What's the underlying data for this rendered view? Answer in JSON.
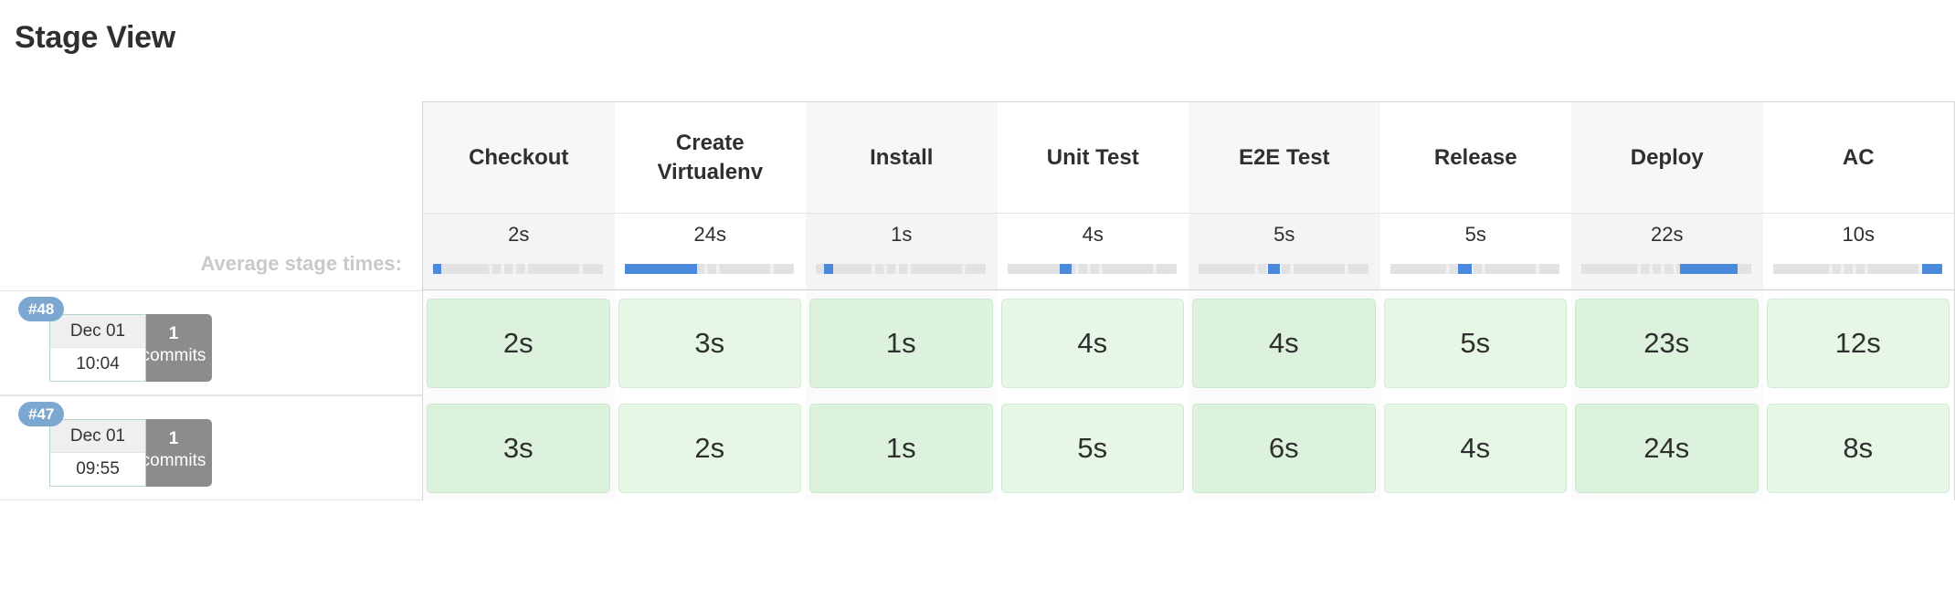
{
  "page": {
    "title": "Stage View"
  },
  "table": {
    "average_label": "Average stage times:",
    "stages": [
      "Checkout",
      "Create Virtualenv",
      "Install",
      "Unit Test",
      "E2E Test",
      "Release",
      "Deploy",
      "AC"
    ],
    "average_times": [
      "2s",
      "24s",
      "1s",
      "4s",
      "5s",
      "5s",
      "22s",
      "10s"
    ],
    "average_bars": [
      {
        "start_pct": 0,
        "width_pct": 5
      },
      {
        "start_pct": 0,
        "width_pct": 43
      },
      {
        "start_pct": 5,
        "width_pct": 5
      },
      {
        "start_pct": 31,
        "width_pct": 7
      },
      {
        "start_pct": 41,
        "width_pct": 7
      },
      {
        "start_pct": 40,
        "width_pct": 8
      },
      {
        "start_pct": 58,
        "width_pct": 34
      },
      {
        "start_pct": 88,
        "width_pct": 12
      }
    ],
    "builds": [
      {
        "id": "#48",
        "date": "Dec 01",
        "time": "10:04",
        "commit_count": "1",
        "commit_label": "commits",
        "times": [
          "2s",
          "3s",
          "1s",
          "4s",
          "4s",
          "5s",
          "23s",
          "12s"
        ]
      },
      {
        "id": "#47",
        "date": "Dec 01",
        "time": "09:55",
        "commit_count": "1",
        "commit_label": "commits",
        "times": [
          "3s",
          "2s",
          "1s",
          "5s",
          "6s",
          "4s",
          "24s",
          "8s"
        ]
      }
    ]
  },
  "colors": {
    "accent_blue": "#4a89dc",
    "build_pill": "#7ba7d1",
    "commit_gray": "#8c8c8c",
    "stage_success_bg": "#e6f7e6",
    "stage_success_border": "#d2e9d2",
    "label_gray": "#c9c9c9"
  }
}
